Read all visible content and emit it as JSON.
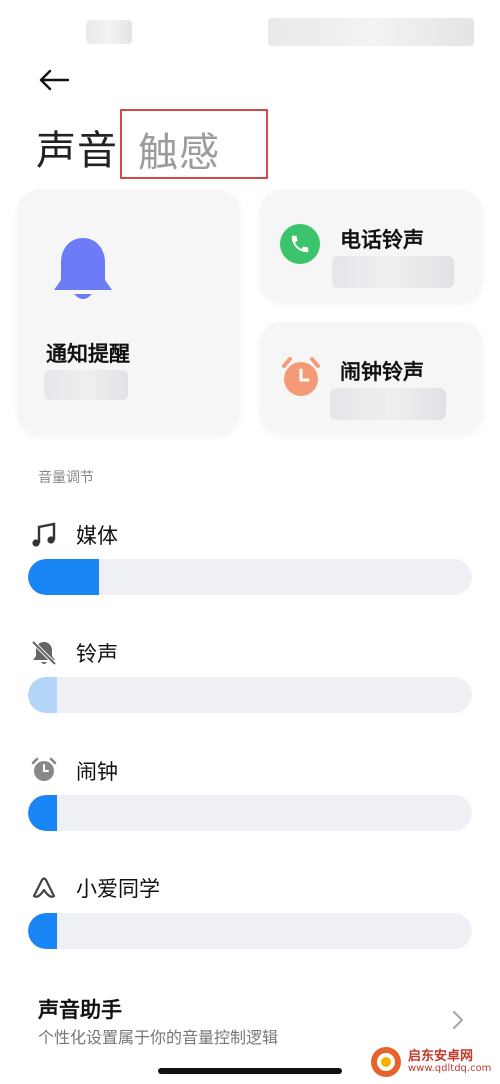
{
  "header": {
    "back_icon": "arrow-left-icon",
    "tabs": [
      {
        "label": "声音",
        "active": true
      },
      {
        "label": "触感",
        "active": false
      }
    ]
  },
  "cards": {
    "notification": {
      "label": "通知提醒",
      "icon": "bell-icon",
      "color": "#6d7cf6"
    },
    "phone": {
      "label": "电话铃声",
      "icon": "phone-icon",
      "color": "#3bc46b"
    },
    "alarm": {
      "label": "闹钟铃声",
      "icon": "alarm-clock-icon",
      "color": "#f49a76"
    }
  },
  "volume": {
    "section_title": "音量调节",
    "rows": [
      {
        "label": "媒体",
        "icon": "music-note-icon",
        "level": 0.16,
        "fill": "#1a85f5"
      },
      {
        "label": "铃声",
        "icon": "bell-muted-icon",
        "level": 0.065,
        "fill": "#b3d5f8"
      },
      {
        "label": "闹钟",
        "icon": "alarm-icon",
        "level": 0.065,
        "fill": "#1a85f5"
      },
      {
        "label": "小爱同学",
        "icon": "xiaoai-icon",
        "level": 0.065,
        "fill": "#1a85f5"
      }
    ]
  },
  "assistant": {
    "title": "声音助手",
    "subtitle": "个性化设置属于你的音量控制逻辑",
    "chevron": "chevron-right-icon"
  },
  "watermark": {
    "name": "启东安卓网",
    "url": "www.qdltdq.com"
  }
}
